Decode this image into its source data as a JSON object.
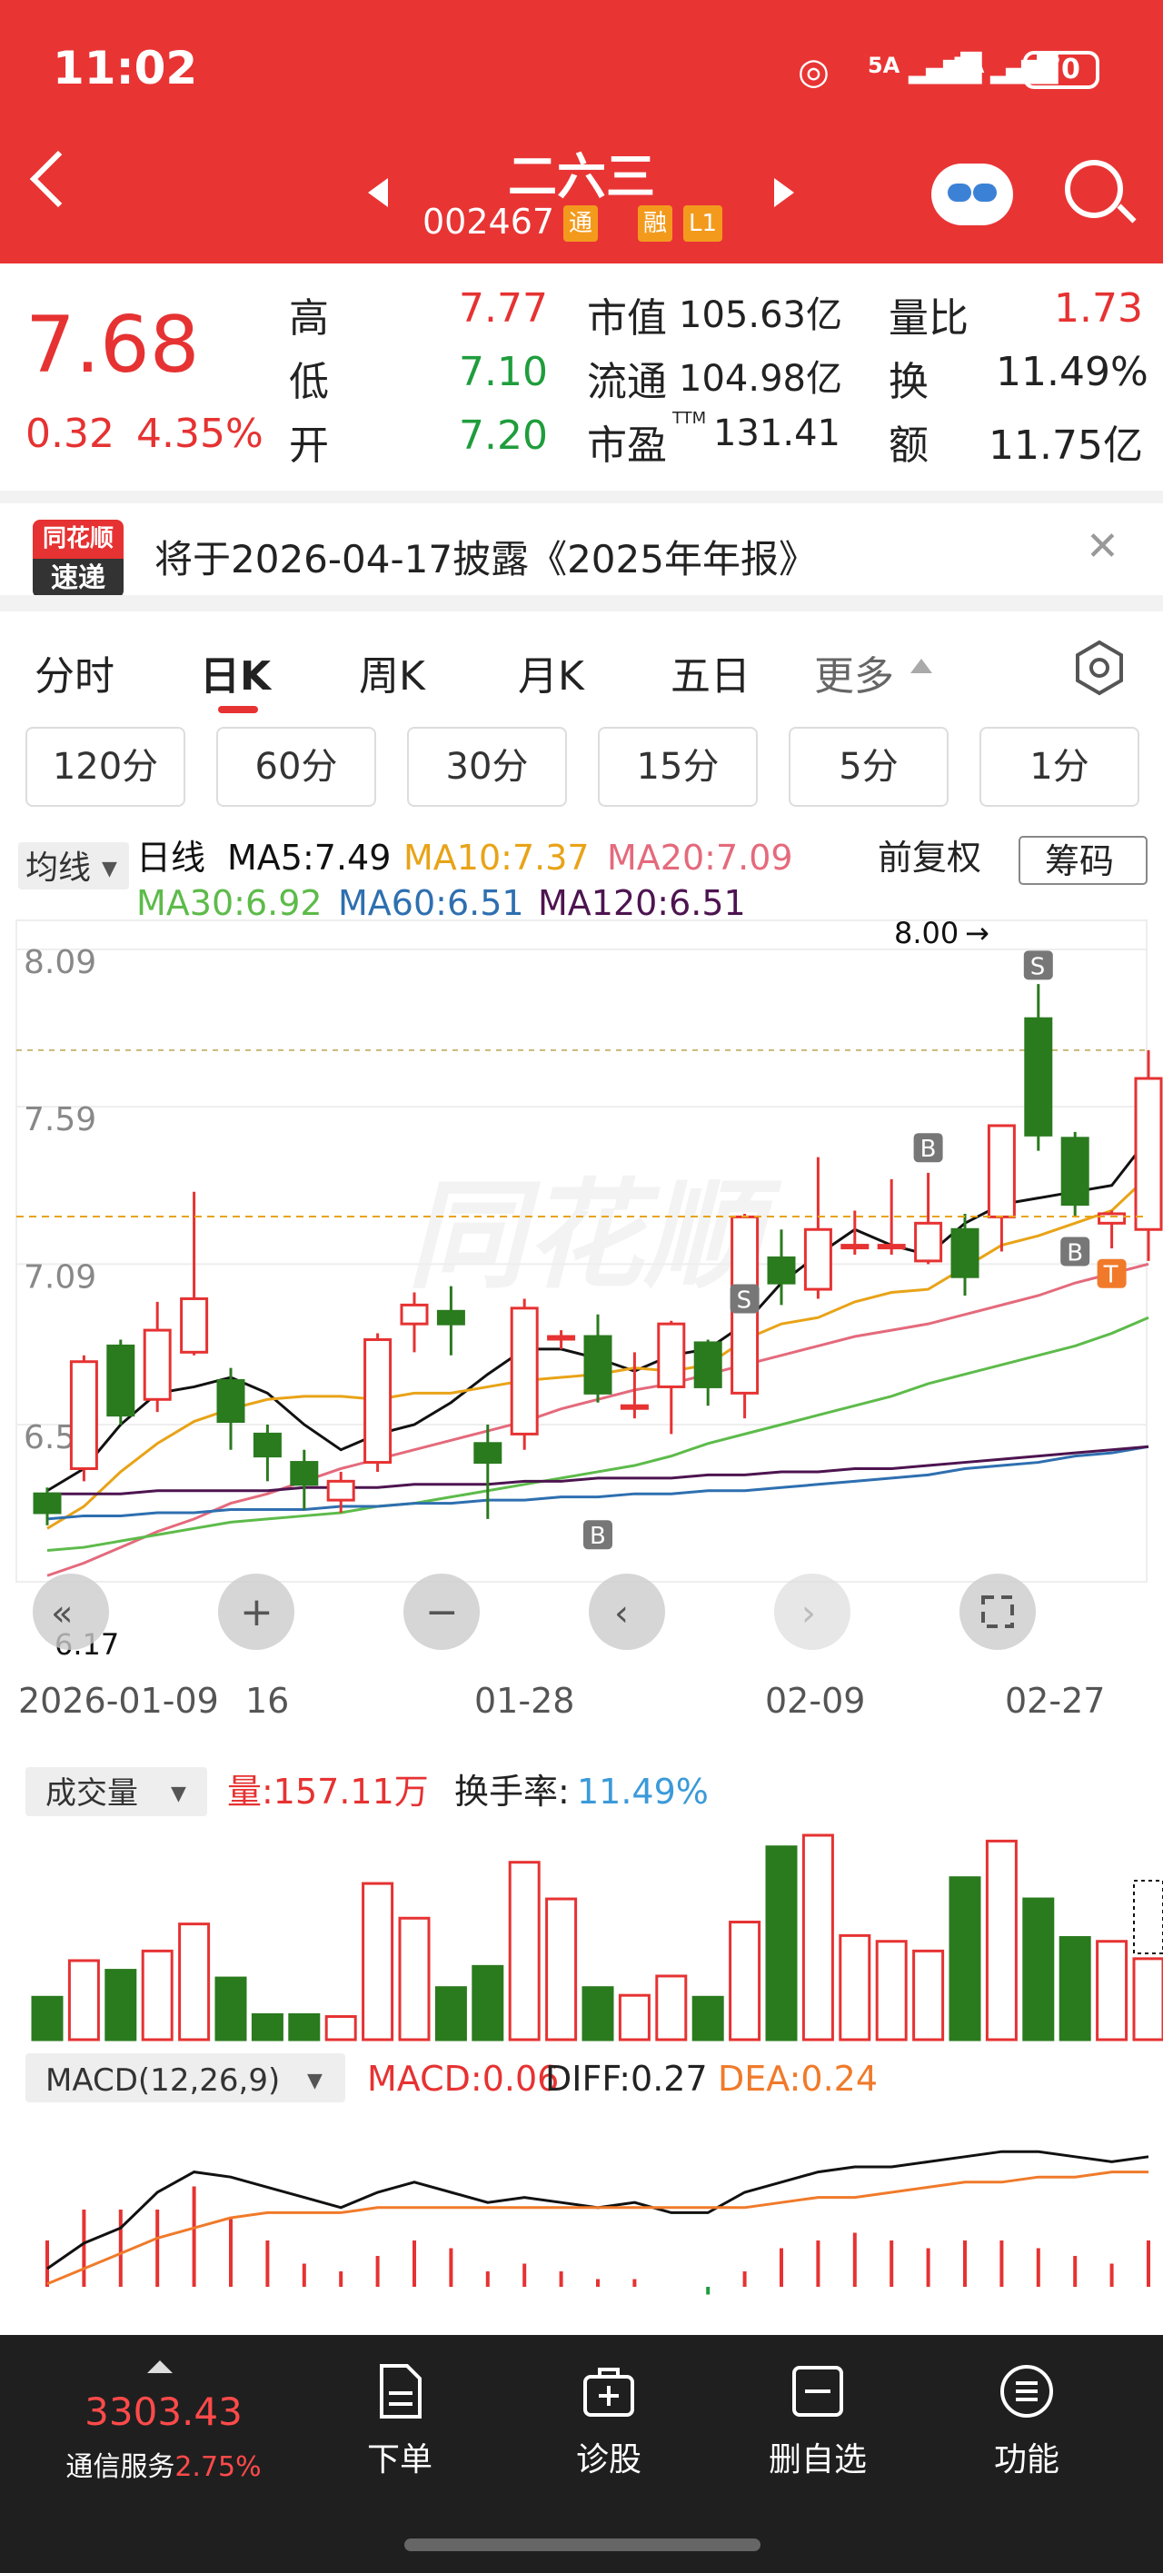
{
  "status_bar": {
    "time": "11:02",
    "sig1": "5A",
    "sig2": "5A",
    "battery": "70"
  },
  "header": {
    "name": "二六三",
    "code": "002467",
    "tag1": "通",
    "tag2": "融",
    "tag3": "L1"
  },
  "quote": {
    "price": "7.68",
    "change": "0.32",
    "change_pct": "4.35%",
    "high_label": "高",
    "high": "7.77",
    "low_label": "低",
    "low": "7.10",
    "open_label": "开",
    "open": "7.20",
    "mcap_label": "市值",
    "mcap": "105.63亿",
    "float_label": "流通",
    "float": "104.98亿",
    "pe_label": "市盈",
    "pe_sup": "TTM",
    "pe": "131.41",
    "vr_label": "量比",
    "vr": "1.73",
    "turn_label": "换",
    "turn": "11.49%",
    "amt_label": "额",
    "amt": "11.75亿"
  },
  "notice": {
    "logo_top": "同花顺",
    "logo_bottom": "速递",
    "text": "将于2026-04-17披露《2025年年报》"
  },
  "tabs": [
    "分时",
    "日K",
    "周K",
    "月K",
    "五日",
    "更多"
  ],
  "intervals": [
    "120分",
    "60分",
    "30分",
    "15分",
    "5分",
    "1分"
  ],
  "chart": {
    "ma_btn": "均线",
    "daily": "日线",
    "ma5": "MA5:7.49",
    "ma10": "MA10:7.37",
    "ma20": "MA20:7.09",
    "ma30": "MA30:6.92",
    "ma60": "MA60:6.51",
    "ma120": "MA120:6.51",
    "adj": "前复权",
    "chips": "筹码",
    "y_ticks": [
      "8.09",
      "7.59",
      "7.09",
      "6.58",
      "6.17"
    ],
    "max_label": "8.00",
    "x_ticks": [
      "2026-01-09",
      "16",
      "01-28",
      "02-09",
      "02-27"
    ],
    "vol_btn": "成交量",
    "vol_label": "量:157.11万",
    "turn_label": "换手率:",
    "turn_value": "11.49%",
    "macd_btn": "MACD(12,26,9)",
    "macd": "MACD:0.06",
    "diff": "DIFF:0.27",
    "dea": "DEA:0.24",
    "watermark": "同花顺"
  },
  "chart_data": {
    "type": "candlestick",
    "ylim": [
      6.17,
      8.09
    ],
    "x_ticks": [
      "2026-01-09",
      "16",
      "01-28",
      "02-09",
      "02-27"
    ],
    "candles": [
      {
        "o": 6.36,
        "c": 6.3,
        "h": 6.38,
        "l": 6.26
      },
      {
        "o": 6.44,
        "c": 6.78,
        "h": 6.8,
        "l": 6.4
      },
      {
        "o": 6.83,
        "c": 6.61,
        "h": 6.85,
        "l": 6.58
      },
      {
        "o": 6.66,
        "c": 6.88,
        "h": 6.97,
        "l": 6.62
      },
      {
        "o": 6.81,
        "c": 6.98,
        "h": 7.32,
        "l": 6.8
      },
      {
        "o": 6.72,
        "c": 6.59,
        "h": 6.76,
        "l": 6.5
      },
      {
        "o": 6.55,
        "c": 6.48,
        "h": 6.58,
        "l": 6.4
      },
      {
        "o": 6.46,
        "c": 6.39,
        "h": 6.5,
        "l": 6.31
      },
      {
        "o": 6.34,
        "c": 6.4,
        "h": 6.43,
        "l": 6.3
      },
      {
        "o": 6.46,
        "c": 6.85,
        "h": 6.87,
        "l": 6.43
      },
      {
        "o": 6.9,
        "c": 6.96,
        "h": 7.0,
        "l": 6.81
      },
      {
        "o": 6.94,
        "c": 6.9,
        "h": 7.02,
        "l": 6.8
      },
      {
        "o": 6.52,
        "c": 6.46,
        "h": 6.58,
        "l": 6.28
      },
      {
        "o": 6.55,
        "c": 6.95,
        "h": 6.98,
        "l": 6.5
      },
      {
        "o": 6.86,
        "c": 6.86,
        "h": 6.88,
        "l": 6.82
      },
      {
        "o": 6.86,
        "c": 6.68,
        "h": 6.93,
        "l": 6.65
      },
      {
        "o": 6.64,
        "c": 6.64,
        "h": 6.81,
        "l": 6.6
      },
      {
        "o": 6.7,
        "c": 6.9,
        "h": 6.91,
        "l": 6.55
      },
      {
        "o": 6.84,
        "c": 6.7,
        "h": 6.85,
        "l": 6.64
      },
      {
        "o": 6.68,
        "c": 7.24,
        "h": 7.25,
        "l": 6.6
      },
      {
        "o": 7.11,
        "c": 7.03,
        "h": 7.2,
        "l": 6.96
      },
      {
        "o": 7.01,
        "c": 7.2,
        "h": 7.43,
        "l": 6.98
      },
      {
        "o": 7.15,
        "c": 7.15,
        "h": 7.26,
        "l": 7.12
      },
      {
        "o": 7.15,
        "c": 7.15,
        "h": 7.36,
        "l": 7.12
      },
      {
        "o": 7.1,
        "c": 7.22,
        "h": 7.38,
        "l": 7.09
      },
      {
        "o": 7.2,
        "c": 7.05,
        "h": 7.25,
        "l": 6.99
      },
      {
        "o": 7.24,
        "c": 7.53,
        "h": 7.53,
        "l": 7.13
      },
      {
        "o": 7.87,
        "c": 7.5,
        "h": 7.98,
        "l": 7.45
      },
      {
        "o": 7.49,
        "c": 7.28,
        "h": 7.51,
        "l": 7.24
      },
      {
        "o": 7.22,
        "c": 7.25,
        "h": 7.26,
        "l": 7.14
      },
      {
        "o": 7.2,
        "c": 7.68,
        "h": 7.77,
        "l": 7.1
      }
    ],
    "series": [
      {
        "name": "MA5",
        "color": "#111111",
        "values": [
          6.37,
          6.44,
          6.58,
          6.68,
          6.7,
          6.73,
          6.68,
          6.58,
          6.5,
          6.55,
          6.58,
          6.65,
          6.74,
          6.82,
          6.82,
          6.79,
          6.75,
          6.8,
          6.82,
          6.9,
          7.03,
          7.12,
          7.2,
          7.15,
          7.12,
          7.22,
          7.28,
          7.3,
          7.32,
          7.34,
          7.49
        ]
      },
      {
        "name": "MA10",
        "color": "#e8a317",
        "values": [
          6.25,
          6.32,
          6.43,
          6.52,
          6.59,
          6.63,
          6.66,
          6.67,
          6.67,
          6.66,
          6.68,
          6.68,
          6.7,
          6.72,
          6.73,
          6.74,
          6.76,
          6.75,
          6.77,
          6.85,
          6.9,
          6.92,
          6.97,
          7.0,
          7.01,
          7.08,
          7.15,
          7.18,
          7.22,
          7.26,
          7.37
        ]
      },
      {
        "name": "MA20",
        "color": "#e46a7c",
        "values": [
          6.1,
          6.14,
          6.19,
          6.24,
          6.28,
          6.33,
          6.36,
          6.4,
          6.44,
          6.47,
          6.5,
          6.53,
          6.56,
          6.59,
          6.63,
          6.66,
          6.69,
          6.71,
          6.74,
          6.77,
          6.8,
          6.83,
          6.86,
          6.88,
          6.9,
          6.93,
          6.96,
          6.99,
          7.03,
          7.06,
          7.09
        ]
      },
      {
        "name": "MA30",
        "color": "#5dbb4a",
        "values": [
          6.18,
          6.19,
          6.21,
          6.23,
          6.25,
          6.27,
          6.28,
          6.29,
          6.3,
          6.32,
          6.33,
          6.35,
          6.37,
          6.39,
          6.41,
          6.43,
          6.45,
          6.48,
          6.52,
          6.55,
          6.58,
          6.61,
          6.64,
          6.67,
          6.71,
          6.74,
          6.77,
          6.8,
          6.83,
          6.87,
          6.92
        ]
      },
      {
        "name": "MA60",
        "color": "#2e6fb0",
        "values": [
          6.28,
          6.29,
          6.29,
          6.3,
          6.3,
          6.31,
          6.31,
          6.31,
          6.32,
          6.32,
          6.33,
          6.33,
          6.34,
          6.34,
          6.35,
          6.35,
          6.36,
          6.36,
          6.37,
          6.37,
          6.38,
          6.39,
          6.4,
          6.41,
          6.42,
          6.44,
          6.45,
          6.46,
          6.48,
          6.49,
          6.51
        ]
      },
      {
        "name": "MA120",
        "color": "#4d1450",
        "values": [
          6.36,
          6.36,
          6.36,
          6.37,
          6.37,
          6.37,
          6.37,
          6.38,
          6.38,
          6.38,
          6.39,
          6.39,
          6.39,
          6.4,
          6.4,
          6.41,
          6.41,
          6.41,
          6.42,
          6.42,
          6.43,
          6.43,
          6.44,
          6.44,
          6.45,
          6.46,
          6.47,
          6.48,
          6.49,
          6.5,
          6.51
        ]
      }
    ],
    "volume": [
      0.22,
      0.41,
      0.36,
      0.46,
      0.6,
      0.32,
      0.13,
      0.13,
      0.12,
      0.81,
      0.63,
      0.27,
      0.38,
      0.92,
      0.73,
      0.27,
      0.23,
      0.33,
      0.22,
      0.61,
      1.0,
      1.06,
      0.54,
      0.51,
      0.46,
      0.84,
      1.03,
      0.73,
      0.53,
      0.51,
      0.42
    ],
    "diff": [
      0.05,
      0.1,
      0.13,
      0.2,
      0.24,
      0.23,
      0.21,
      0.19,
      0.17,
      0.2,
      0.22,
      0.2,
      0.18,
      0.19,
      0.18,
      0.17,
      0.18,
      0.16,
      0.16,
      0.2,
      0.22,
      0.24,
      0.25,
      0.25,
      0.26,
      0.27,
      0.28,
      0.28,
      0.27,
      0.26,
      0.27
    ],
    "dea": [
      0.02,
      0.05,
      0.08,
      0.11,
      0.13,
      0.15,
      0.16,
      0.16,
      0.16,
      0.17,
      0.17,
      0.17,
      0.17,
      0.17,
      0.17,
      0.17,
      0.17,
      0.17,
      0.17,
      0.17,
      0.18,
      0.19,
      0.19,
      0.2,
      0.21,
      0.22,
      0.22,
      0.23,
      0.23,
      0.24,
      0.24
    ],
    "macd_hist": [
      0.06,
      0.1,
      0.1,
      0.1,
      0.13,
      0.09,
      0.06,
      0.03,
      0.02,
      0.04,
      0.06,
      0.05,
      0.02,
      0.03,
      0.02,
      0.01,
      0.01,
      0.0,
      -0.01,
      0.02,
      0.05,
      0.06,
      0.07,
      0.06,
      0.05,
      0.06,
      0.06,
      0.05,
      0.04,
      0.03,
      0.06
    ]
  },
  "bottom_nav": {
    "index_value": "3303.43",
    "index_name": "通信服务",
    "index_pct": "2.75%",
    "order": "下单",
    "diagnose": "诊股",
    "remove": "删自选",
    "func": "功能"
  }
}
